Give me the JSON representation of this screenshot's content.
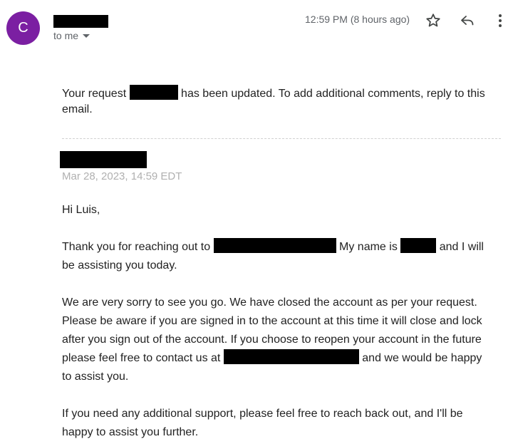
{
  "email": {
    "avatar_letter": "C",
    "recipient_label": "to me",
    "timestamp": "12:59 PM (8 hours ago)",
    "icons": [
      "star-icon",
      "reply-icon",
      "more-vert-icon"
    ]
  },
  "body": {
    "request_prefix": "Your request",
    "request_suffix": "has been updated. To add additional comments, reply to this",
    "request_line2": "email.",
    "reply_date": "Mar 28, 2023, 14:59 EDT",
    "greeting": "Hi Luis,",
    "p1_a": "Thank you for reaching out to",
    "p1_b": "My name is",
    "p1_c": "and I will",
    "p1_line2": "be assisting you today.",
    "p2_line1": "We are very sorry to see you go. We have closed the account as per your request.",
    "p2_line2": "Please be aware if you are signed in to the account at this time it will close and lock",
    "p2_line3": "after you sign out of the account. If you choose to reopen your account in the future",
    "p2_line4_a": "please feel free to contact us at",
    "p2_line4_b": "and we would be happy",
    "p2_line5": "to assist you.",
    "p3_line1": "If you need any additional support, please feel free to reach back out, and I'll be",
    "p3_line2": "happy to assist you further."
  }
}
